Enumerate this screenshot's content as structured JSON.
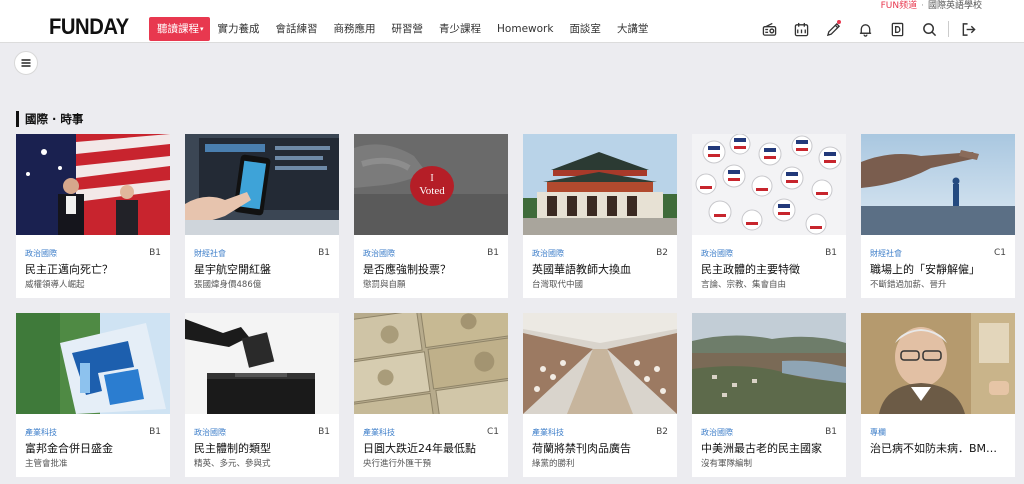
{
  "header": {
    "logo": "FUNDAY",
    "top_links": {
      "fun": "FUN频道",
      "sep": "·",
      "school": "國際英語學校"
    },
    "nav": [
      {
        "label": "聽讀課程",
        "caret": "▾"
      },
      {
        "label": "實力養成"
      },
      {
        "label": "會話練習"
      },
      {
        "label": "商務應用"
      },
      {
        "label": "研習營"
      },
      {
        "label": "青少課程"
      },
      {
        "label": "Homework"
      },
      {
        "label": "面談室"
      },
      {
        "label": "大講堂"
      }
    ],
    "icons": [
      "radio-icon",
      "calendar-icon",
      "pencil-icon",
      "bell-icon",
      "dictionary-icon",
      "search-icon",
      "logout-icon"
    ]
  },
  "section": {
    "title": "國際 · 時事"
  },
  "cards": [
    {
      "category": "政治國際",
      "level": "B1",
      "title": "民主正邁向死亡？",
      "subtitle": "威權領導人崛起"
    },
    {
      "category": "財經社會",
      "level": "B1",
      "title": "星宇航空開紅盤",
      "subtitle": "張國煒身價486億"
    },
    {
      "category": "政治國際",
      "level": "B1",
      "title": "是否應強制投票？",
      "subtitle": "懲罰與自願"
    },
    {
      "category": "政治國際",
      "level": "B2",
      "title": "英國華語教師大換血",
      "subtitle": "台灣取代中國"
    },
    {
      "category": "政治國際",
      "level": "B1",
      "title": "民主政體的主要特徵",
      "subtitle": "言論、宗教、集會自由"
    },
    {
      "category": "財經社會",
      "level": "C1",
      "title": "職場上的「安靜解僱」",
      "subtitle": "不斷錯過加薪、晉升"
    },
    {
      "category": "產業科技",
      "level": "B1",
      "title": "富邦金合併日盛金",
      "subtitle": "主管會批准"
    },
    {
      "category": "政治國際",
      "level": "B1",
      "title": "民主體制的類型",
      "subtitle": "精英、多元、參與式"
    },
    {
      "category": "產業科技",
      "level": "C1",
      "title": "日圓大跌近24年最低點",
      "subtitle": "央行進行外匯干預"
    },
    {
      "category": "產業科技",
      "level": "B2",
      "title": "荷蘭將禁刊肉品廣告",
      "subtitle": "綠黨的勝利"
    },
    {
      "category": "政治國際",
      "level": "B1",
      "title": "中美洲最古老的民主國家",
      "subtitle": "沒有軍隊編制"
    },
    {
      "category": "專欄",
      "level": "",
      "title": "治已病不如防未病．BM…",
      "subtitle": ""
    }
  ],
  "thumb_sign": {
    "line1": "I",
    "line2": "Voted"
  },
  "colors": {
    "accent": "#e8384f",
    "category": "#3d7ec9",
    "background": "#ececf0"
  }
}
